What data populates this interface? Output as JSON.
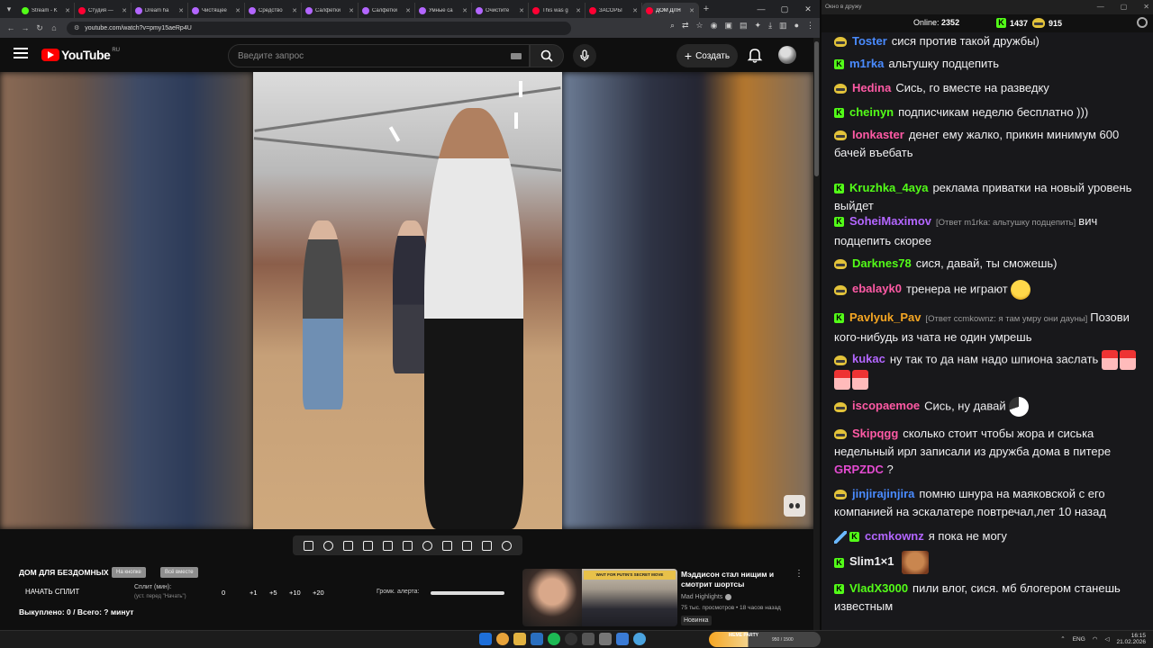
{
  "browser": {
    "tabs": [
      {
        "title": "Stream - K",
        "color": "#53fc18"
      },
      {
        "title": "Студия —",
        "color": "#ff0033"
      },
      {
        "title": "Dream ha",
        "color": "#b366ff"
      },
      {
        "title": "Чистящее",
        "color": "#b366ff"
      },
      {
        "title": "Средство",
        "color": "#b366ff"
      },
      {
        "title": "Салфетки",
        "color": "#b366ff"
      },
      {
        "title": "Салфетки",
        "color": "#b366ff"
      },
      {
        "title": "Умные са",
        "color": "#b366ff"
      },
      {
        "title": "Очистите",
        "color": "#b366ff"
      },
      {
        "title": "This was g",
        "color": "#ff0033"
      },
      {
        "title": "ЗАСОРЫ",
        "color": "#ff0033"
      },
      {
        "title": "ДОМ ДЛЯ",
        "color": "#ff0033",
        "active": true
      }
    ],
    "url": "youtube.com/watch?v=pmy15aeRp4U"
  },
  "youtube": {
    "logo_text": "YouTube",
    "region": "RU",
    "search_placeholder": "Введите запрос",
    "create_label": "Создать"
  },
  "livesplit": {
    "title": "ДОМ ДЛЯ БЕЗДОМНЫХ",
    "pill_1": "На кнопке",
    "pill_2": "Всё вместе",
    "start_label": "НАЧАТЬ СПЛИТ",
    "split_label": "Сплит (мин):",
    "split_hint": "(уст. перед \"Начать\")",
    "increments": [
      "0",
      "+1",
      "+5",
      "+10",
      "+20"
    ],
    "alert_label": "Громк. алерта:",
    "bought": "Выкуплено: 0 / Всего: ? минут"
  },
  "recommendation": {
    "banner": "WAIT FOR PUTIN'S SECRET MOVE",
    "title": "Мэддисон стал нищим и смотрит шортсы",
    "channel": "Mad Highlights",
    "meta": "75 тыс. просмотров • 18 часов назад",
    "badge": "Новинка"
  },
  "chat": {
    "window_title": "Окно в дружу",
    "online_label": "Online:",
    "online_count": "2352",
    "k_count": "1437",
    "pepe_count": "915",
    "messages": [
      {
        "badge": "pepe",
        "user": "Toster",
        "color": "#4a8bff",
        "text": "сися против такой дружбы)"
      },
      {
        "badge": "k",
        "user": "m1rka",
        "color": "#4a8bff",
        "text": "альтушку подцепить"
      },
      {
        "badge": "pepe",
        "user": "Hedina",
        "color": "#ff5aa5",
        "text": "Сись, го вместе на разведку"
      },
      {
        "badge": "k",
        "user": "cheinyn",
        "color": "#53fc18",
        "text": "подписчикам неделю бесплатно )))"
      },
      {
        "badge": "pepe",
        "user": "Ionkaster",
        "color": "#ff5aa5",
        "text": "денег ему жалко, прикин минимум 600 бачей въебать"
      },
      {
        "badge": "k",
        "user": "Kruzhka_4aya",
        "color": "#53fc18",
        "text": "реклама приватки на новый уровень выйдет"
      },
      {
        "badge": "k",
        "user": "SoheiMaximov",
        "color": "#b366ff",
        "reply": "[Ответ m1rka: альтушку подцепить]",
        "text": "вич подцепить скорее"
      },
      {
        "badge": "pepe",
        "user": "Darknes78",
        "color": "#53fc18",
        "text": "сися, давай, ты сможешь)"
      },
      {
        "badge": "pepe",
        "user": "ebalayk0",
        "color": "#ff5aa5",
        "text": "тренера не играют",
        "emote": "laugh"
      },
      {
        "badge": "k",
        "user": "Pavlyuk_Pav",
        "color": "#f5a623",
        "reply": "[Ответ ccmkownz: я там умру они дауны]",
        "text": "Позови кого-нибудь из чата не один умрешь"
      },
      {
        "badge": "pepe",
        "user": "kukac",
        "color": "#b366ff",
        "text": "ну так то да нам надо шпиона заслать",
        "emote": "girls"
      },
      {
        "badge": "pepe",
        "user": "iscopaemoe",
        "color": "#ff5aa5",
        "text": "Сись, ну давай",
        "emote": "spin"
      },
      {
        "badge": "pepe",
        "user": "Skipqgg",
        "color": "#ff5aa5",
        "text": "сколько стоит чтобы жора и сиська недельный ирл записали из дружба дома в питере",
        "mention": "GRPZDC",
        "tail": "?"
      },
      {
        "badge": "pepe",
        "user": "jinjirajinjira",
        "color": "#4a8bff",
        "text": "помню шнура на маяковской с его компанией на эскалатере повтречал,лет 10 назад"
      },
      {
        "badge": "k",
        "user": "ccmkownz",
        "color": "#b366ff",
        "sword": true,
        "text": "я пока не могу"
      },
      {
        "badge": "k",
        "user": "Slim1×1",
        "color": "#efeff1",
        "text": "",
        "emote": "face"
      },
      {
        "badge": "k",
        "user": "VladX3000",
        "color": "#53fc18",
        "text": "пили влог, сися. мб блогером станешь известным"
      }
    ]
  },
  "taskbar": {
    "meme_label": "MEME PARTY",
    "meme_value": "950 / 1500",
    "lang": "ENG",
    "time": "16:15",
    "date": "21.02.2026"
  }
}
